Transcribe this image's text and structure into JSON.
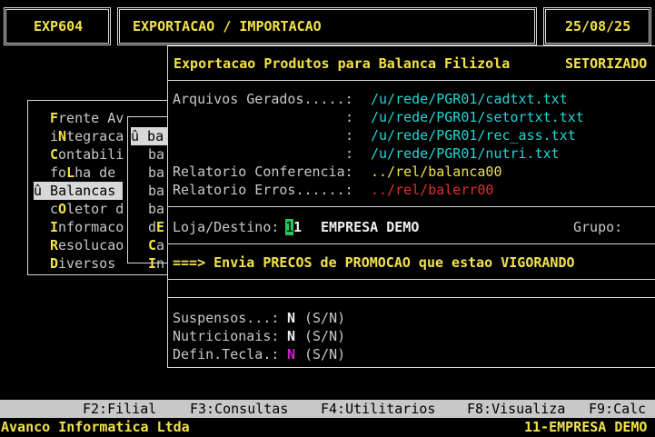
{
  "header": {
    "program_code": "EXP604",
    "title": "EXPORTACAO / IMPORTACAO",
    "date": "25/08/25"
  },
  "main_menu": {
    "items": [
      {
        "hot": "F",
        "rest": "rente Av"
      },
      {
        "pre": "i",
        "hot": "N",
        "rest": "tegraca"
      },
      {
        "hot": "C",
        "rest": "ontabili"
      },
      {
        "pre": "fo",
        "hot": "L",
        "rest": "ha de"
      },
      {
        "full": "û Balancas",
        "selected": true
      },
      {
        "pre": "c",
        "hot": "O",
        "rest": "letor d"
      },
      {
        "hot": "I",
        "rest": "nformaco"
      },
      {
        "hot": "R",
        "rest": "esolucao"
      },
      {
        "hot": "D",
        "rest": "iversos"
      }
    ]
  },
  "sub_menu": {
    "items": [
      {
        "full": "û ba",
        "selected": true
      },
      {
        "full": "ba"
      },
      {
        "full": "ba"
      },
      {
        "full": "ba"
      },
      {
        "full": "ba"
      },
      {
        "pre": "d",
        "hot": "E"
      },
      {
        "hot": "C",
        "rest": "a"
      },
      {
        "hot": "I",
        "rest": "n"
      }
    ]
  },
  "dialog": {
    "title": "Exportacao Produtos para Balanca Filizola",
    "mode": "SETORIZADO",
    "files_label": "Arquivos Gerados.....:",
    "colon": ":",
    "files": [
      "/u/rede/PGR01/cadtxt.txt",
      "/u/rede/PGR01/setortxt.txt",
      "/u/rede/PGR01/rec_ass.txt",
      "/u/rede/PGR01/nutri.txt"
    ],
    "report_label": "Relatorio Conferencia:",
    "report_path": "../rel/balanca00",
    "errors_label": "Relatorio Erros......:",
    "errors_path": "../rel/balerr00",
    "store_label": "Loja/Destino:",
    "store_cursor": "1",
    "store_rest": "1",
    "store_name": "EMPRESA DEMO",
    "group_label": "Grupo:",
    "message": "===> Envia PRECOS de PROMOCAO que estao VIGORANDO",
    "suspended_label": "Suspensos...:",
    "suspended_value": "N",
    "nutritional_label": "Nutricionais:",
    "nutritional_value": "N",
    "key_label": "Defin.Tecla.:",
    "key_value": "N",
    "yn_hint": "(S/N)"
  },
  "function_keys": [
    "F2:Filial",
    "F3:Consultas",
    "F4:Utilitarios",
    "F8:Visualiza",
    "F9:Calc"
  ],
  "status_bar": {
    "company": "Avanco Informatica Ltda",
    "branch": "11-EMPRESA DEMO"
  }
}
